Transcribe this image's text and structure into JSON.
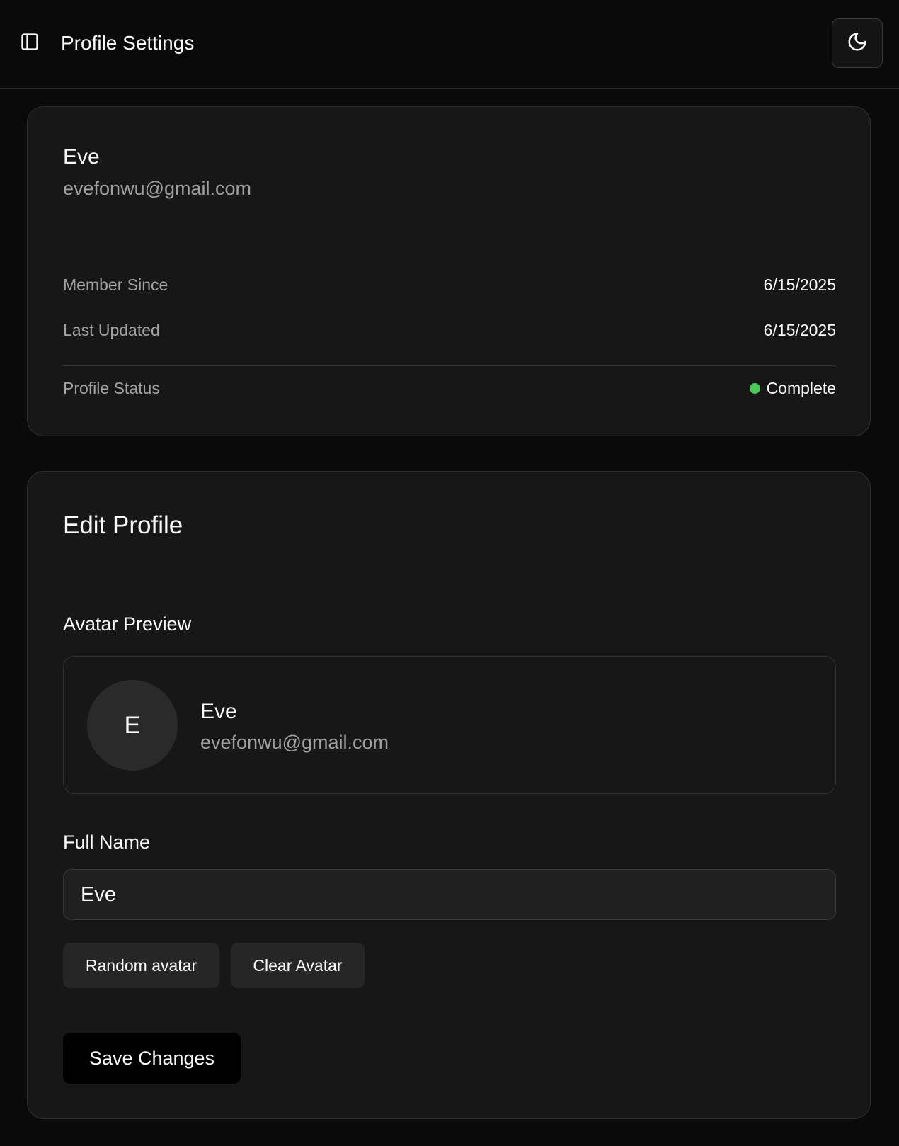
{
  "header": {
    "title": "Profile Settings",
    "sidebar_toggle_icon": "sidebar-toggle-icon",
    "theme_icon": "moon-icon"
  },
  "profile_card": {
    "name": "Eve",
    "email": "evefonwu@gmail.com",
    "member_since_label": "Member Since",
    "member_since_value": "6/15/2025",
    "last_updated_label": "Last Updated",
    "last_updated_value": "6/15/2025",
    "status_label": "Profile Status",
    "status_value": "Complete",
    "status_color": "#4ec85a"
  },
  "edit_card": {
    "title": "Edit Profile",
    "avatar_preview_label": "Avatar Preview",
    "avatar_initial": "E",
    "preview_name": "Eve",
    "preview_email": "evefonwu@gmail.com",
    "full_name_label": "Full Name",
    "full_name_value": "Eve",
    "random_avatar_label": "Random avatar",
    "clear_avatar_label": "Clear Avatar",
    "save_label": "Save Changes"
  }
}
